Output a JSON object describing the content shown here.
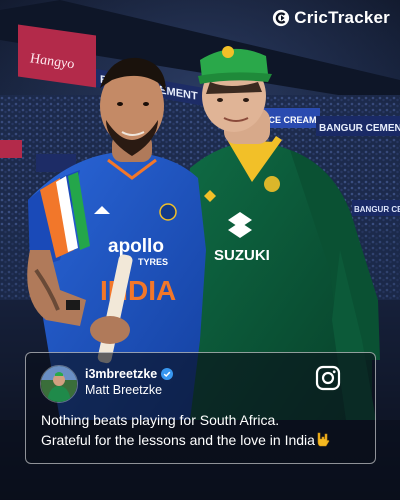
{
  "brand": {
    "name": "CricTracker"
  },
  "stadium_signage": {
    "sign_1": "Hangyo",
    "sign_2": "BANGUR CEMENT",
    "sign_3": "ICE CREAM",
    "sign_4": "BANGUR CEMENT",
    "sign_5": "BANGUR CEME"
  },
  "players": {
    "left": {
      "jersey_sponsor": "apollo",
      "jersey_sponsor_sub": "TYRES",
      "jersey_country": "INDIA"
    },
    "right": {
      "jersey_sponsor": "SUZUKI"
    }
  },
  "post": {
    "handle": "i3mbreetzke",
    "display_name": "Matt Breetzke",
    "line_1": "Nothing beats playing for South Africa.",
    "line_2": "Grateful for the lessons and the love in India",
    "emoji": "🤟",
    "platform_icon": "instagram-icon",
    "verified_icon": "verified-badge-icon"
  },
  "colors": {
    "india_blue": "#1f56c8",
    "sa_green": "#0d5a3a",
    "sa_gold": "#f2c028",
    "verified": "#3897f0"
  }
}
